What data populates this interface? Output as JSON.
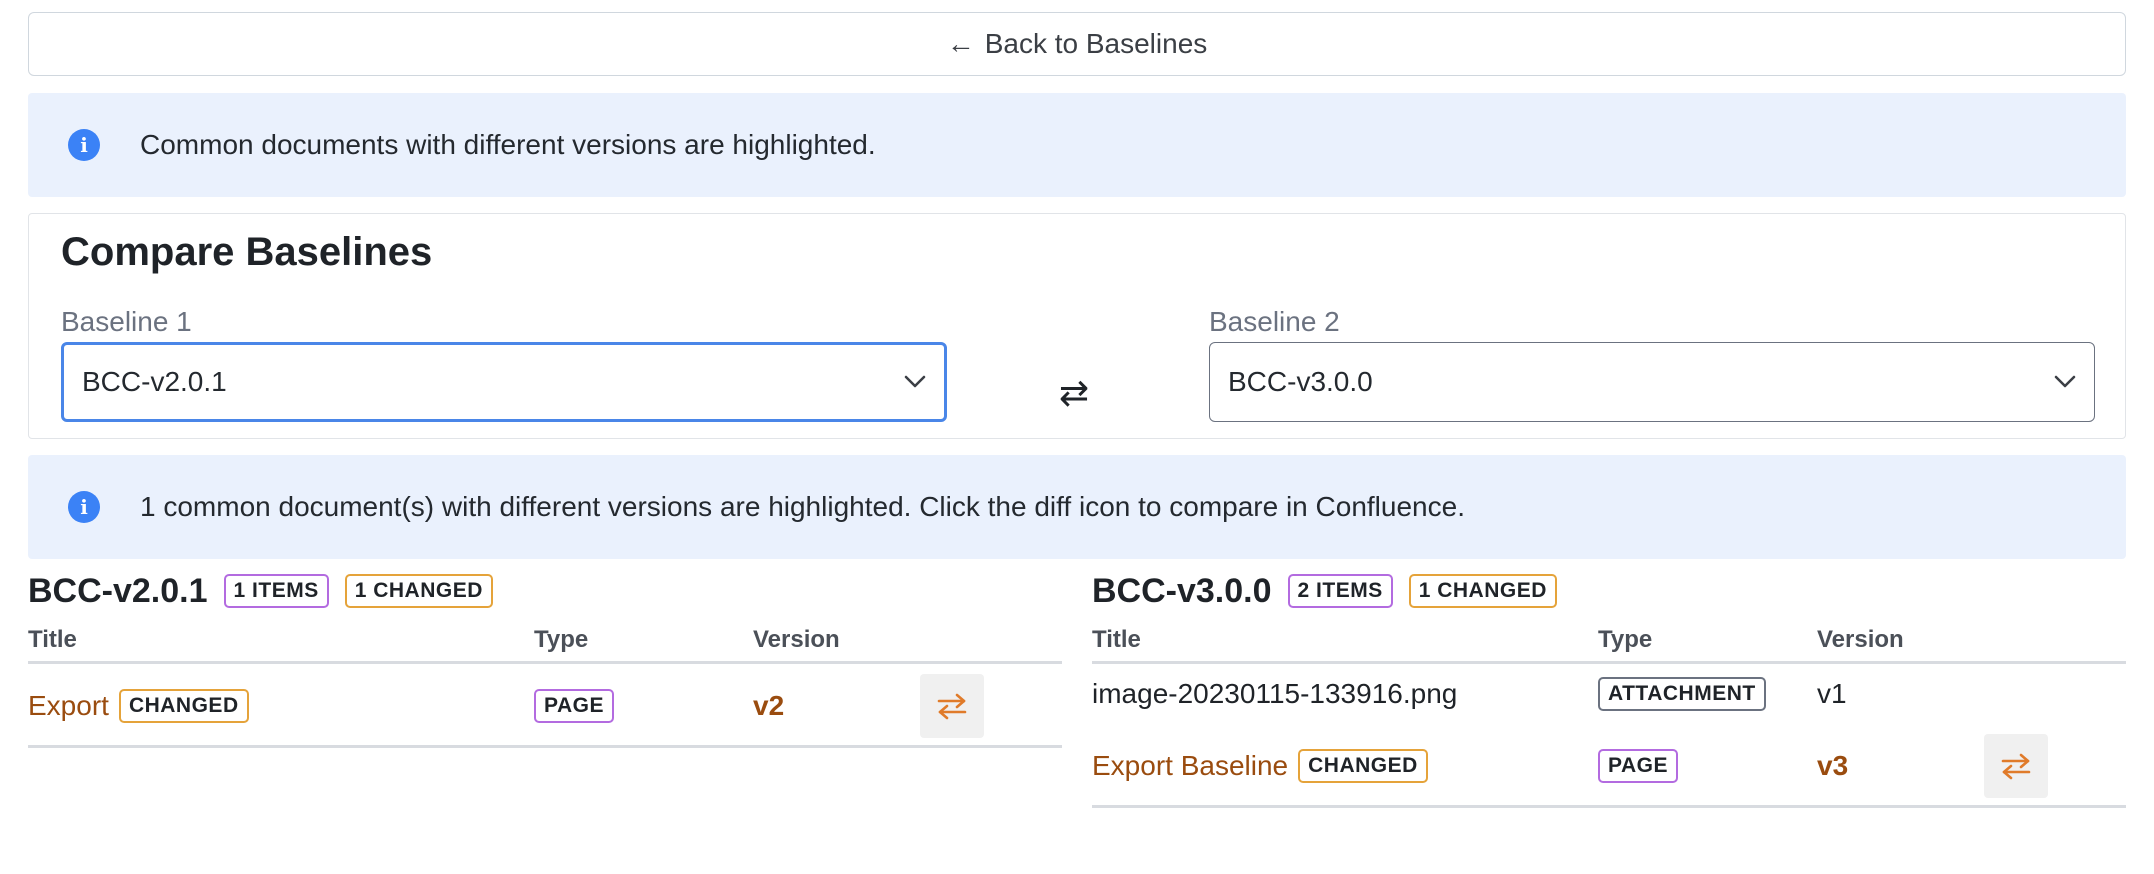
{
  "back_button": {
    "arrow": "←",
    "label": "Back to Baselines"
  },
  "info_top": {
    "icon": "info-icon",
    "text": "Common documents with different versions are highlighted."
  },
  "compare": {
    "title": "Compare Baselines",
    "baseline1": {
      "label": "Baseline 1",
      "value": "BCC-v2.0.1"
    },
    "baseline2": {
      "label": "Baseline 2",
      "value": "BCC-v3.0.0"
    },
    "swap_symbol": "⇄"
  },
  "info_bottom": {
    "icon": "info-icon",
    "text": "1 common document(s) with different versions are highlighted. Click the diff icon to compare in Confluence."
  },
  "columns": {
    "title": "Title",
    "type": "Type",
    "version": "Version"
  },
  "left_panel": {
    "name": "BCC-v2.0.1",
    "items_badge": "1 ITEMS",
    "changed_badge": "1 CHANGED",
    "rows": [
      {
        "title": "Export",
        "changed_badge": "CHANGED",
        "type": "PAGE",
        "version": "v2"
      }
    ]
  },
  "right_panel": {
    "name": "BCC-v3.0.0",
    "items_badge": "2 ITEMS",
    "changed_badge": "1 CHANGED",
    "rows": [
      {
        "title": "image-20230115-133916.png",
        "type": "ATTACHMENT",
        "version": "v1"
      },
      {
        "title": "Export Baseline",
        "changed_badge": "CHANGED",
        "type": "PAGE",
        "version": "v3"
      }
    ]
  },
  "colors": {
    "accent_blue": "#4a86e8",
    "info_bg": "#eaf1fd",
    "changed_text": "#9a4c0f",
    "changed_border": "#e5a33a",
    "type_border": "#b36be0",
    "diff_icon": "#e07b2a"
  }
}
